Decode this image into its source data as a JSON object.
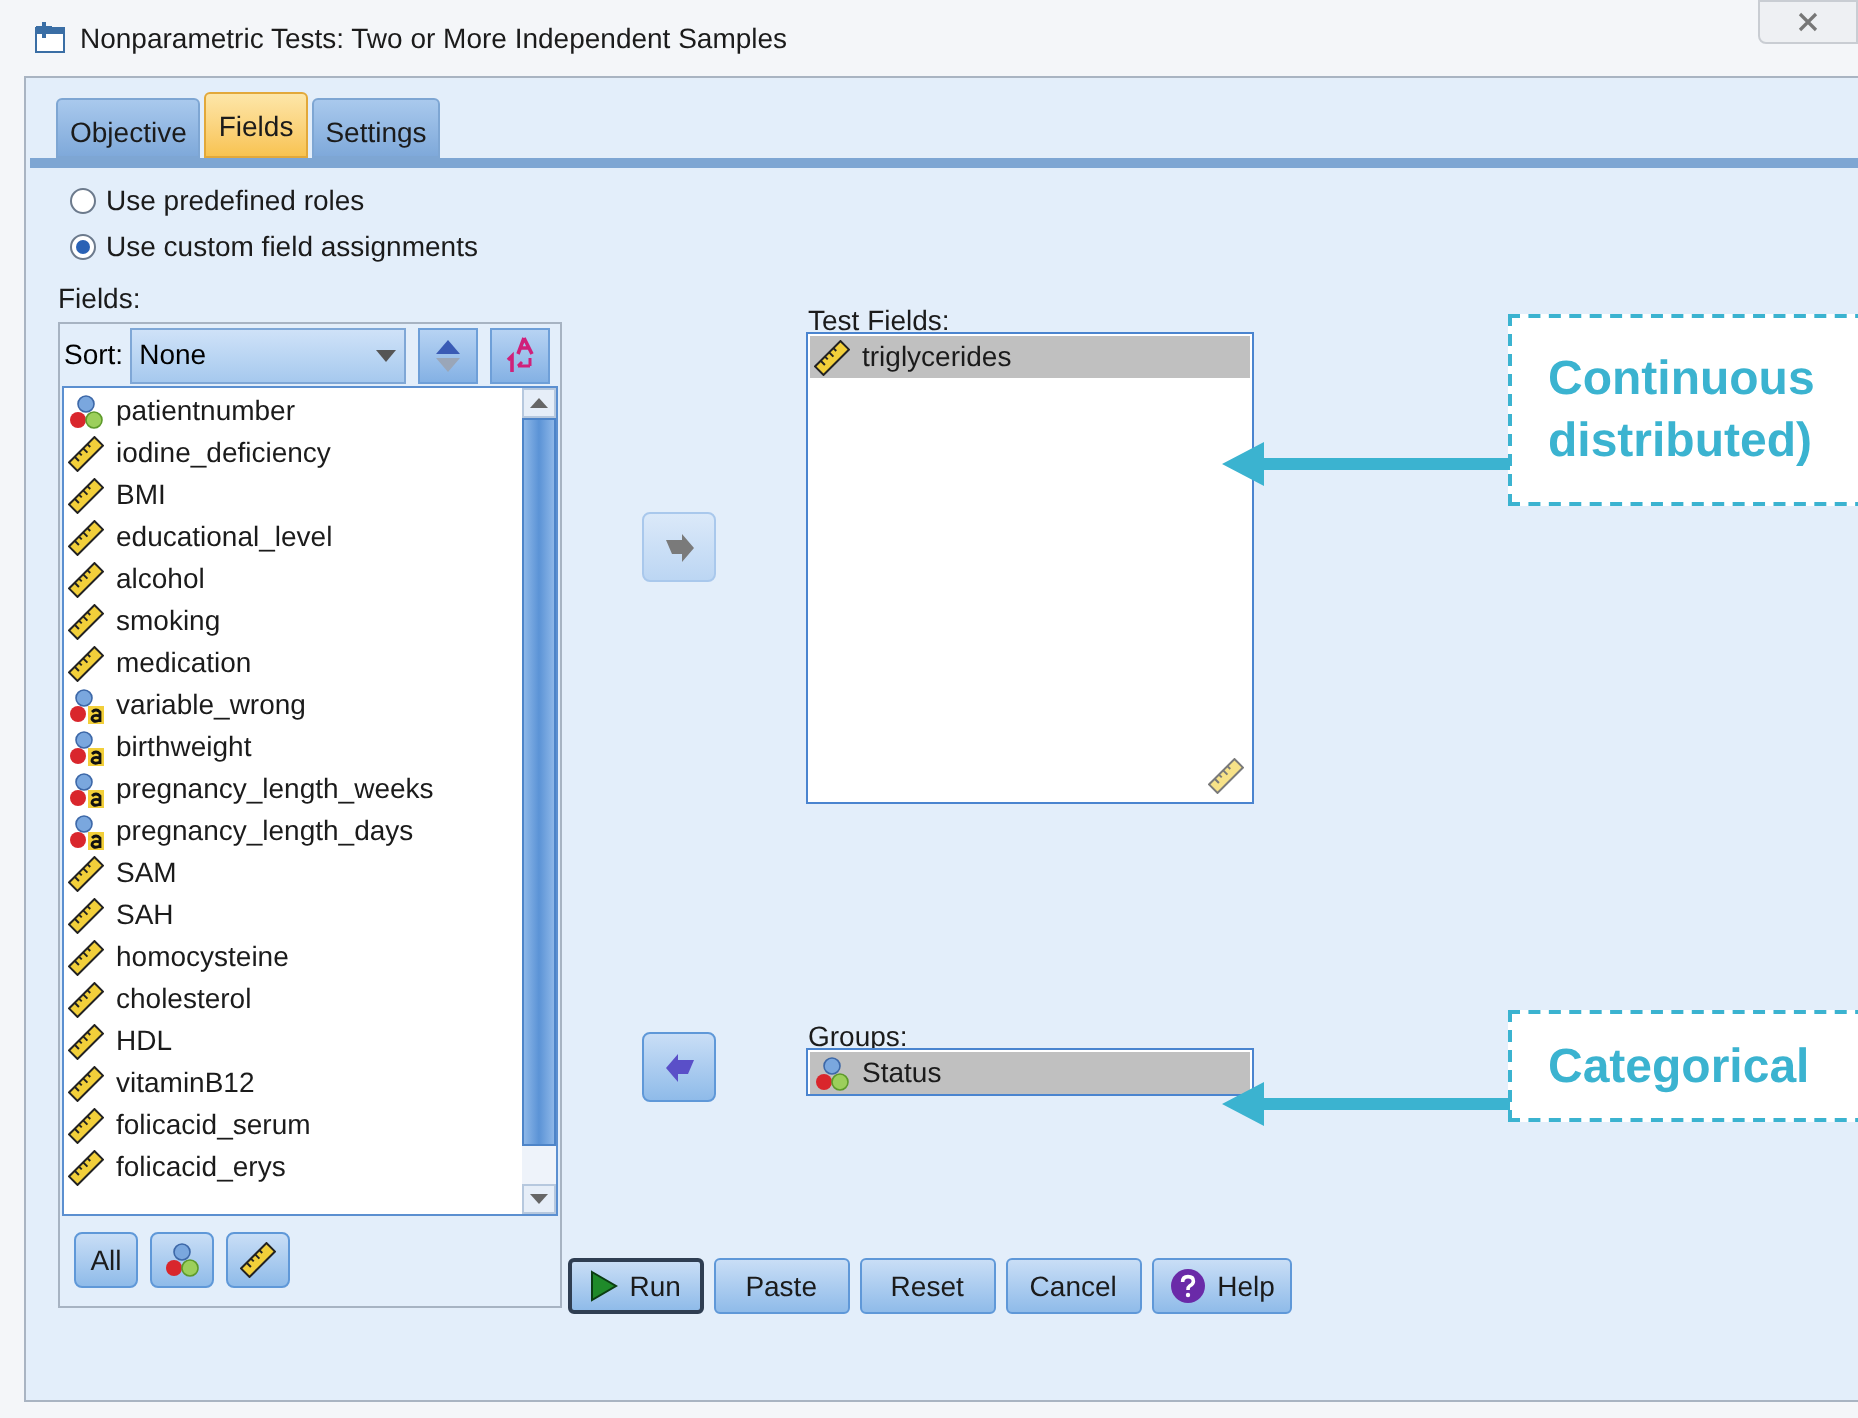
{
  "window": {
    "title": "Nonparametric Tests: Two or More Independent Samples"
  },
  "tabs": [
    {
      "label": "Objective",
      "selected": false
    },
    {
      "label": "Fields",
      "selected": true
    },
    {
      "label": "Settings",
      "selected": false
    }
  ],
  "role_options": [
    {
      "label": "Use predefined roles",
      "selected": false
    },
    {
      "label": "Use custom field assignments",
      "selected": true
    }
  ],
  "fields": {
    "label": "Fields:",
    "sort_label": "Sort:",
    "sort_value": "None",
    "items": [
      {
        "name": "patientnumber",
        "kind": "nominal",
        "selected": false
      },
      {
        "name": "iodine_deficiency",
        "kind": "scale",
        "selected": false
      },
      {
        "name": "BMI",
        "kind": "scale",
        "selected": false
      },
      {
        "name": "educational_level",
        "kind": "scale",
        "selected": false
      },
      {
        "name": "alcohol",
        "kind": "scale",
        "selected": false
      },
      {
        "name": "smoking",
        "kind": "scale",
        "selected": false
      },
      {
        "name": "medication",
        "kind": "scale",
        "selected": false
      },
      {
        "name": "variable_wrong",
        "kind": "nominal_string",
        "selected": false
      },
      {
        "name": "birthweight",
        "kind": "nominal_string",
        "selected": false
      },
      {
        "name": "pregnancy_length_weeks",
        "kind": "nominal_string",
        "selected": false
      },
      {
        "name": "pregnancy_length_days",
        "kind": "nominal_string",
        "selected": false
      },
      {
        "name": "SAM",
        "kind": "scale",
        "selected": false
      },
      {
        "name": "SAH",
        "kind": "scale",
        "selected": false
      },
      {
        "name": "homocysteine",
        "kind": "scale",
        "selected": false
      },
      {
        "name": "cholesterol",
        "kind": "scale",
        "selected": false
      },
      {
        "name": "HDL",
        "kind": "scale",
        "selected": false
      },
      {
        "name": "vitaminB12",
        "kind": "scale",
        "selected": false
      },
      {
        "name": "folicacid_serum",
        "kind": "scale",
        "selected": false
      },
      {
        "name": "folicacid_erys",
        "kind": "scale",
        "selected": false
      }
    ]
  },
  "filter_buttons": [
    {
      "kind": "text",
      "label": "All"
    },
    {
      "kind": "nominal"
    },
    {
      "kind": "scale"
    }
  ],
  "test_fields": {
    "label": "Test Fields:",
    "move_button": {
      "kind": "right",
      "disabled": true
    },
    "items": [
      {
        "name": "triglycerides",
        "kind": "scale",
        "selected": true
      }
    ]
  },
  "groups": {
    "label": "Groups:",
    "move_button": {
      "kind": "left",
      "disabled": false
    },
    "items": [
      {
        "name": "Status",
        "kind": "nominal",
        "selected": true
      }
    ]
  },
  "buttons": [
    {
      "label": "Run",
      "kind": "run"
    },
    {
      "label": "Paste",
      "kind": "plain"
    },
    {
      "label": "Reset",
      "kind": "plain"
    },
    {
      "label": "Cancel",
      "kind": "plain"
    },
    {
      "label": "Help",
      "kind": "help"
    }
  ],
  "callouts": [
    {
      "lines": [
        "Continuous",
        "distributed)"
      ]
    },
    {
      "lines": [
        "Categorical"
      ]
    }
  ]
}
